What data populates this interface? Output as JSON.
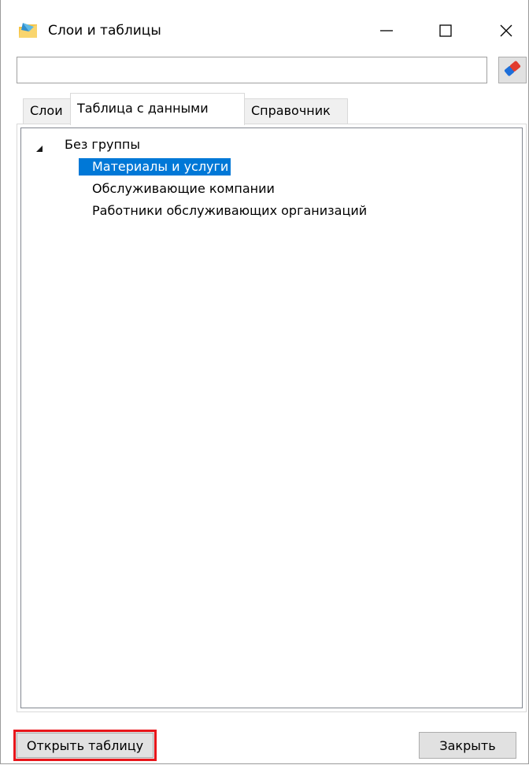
{
  "window": {
    "title": "Слои и таблицы",
    "app_icon": "folder-envelope-icon",
    "controls": {
      "minimize_icon": "minimize-icon",
      "maximize_icon": "maximize-icon",
      "close_icon": "close-icon"
    }
  },
  "search": {
    "value": "",
    "placeholder": "",
    "clear_icon": "eraser-icon"
  },
  "tabs": [
    {
      "label": "Слои",
      "selected": false
    },
    {
      "label": "Таблица с данными",
      "selected": true
    },
    {
      "label": "Справочник",
      "selected": false
    }
  ],
  "tree": {
    "group": {
      "label": "Без группы",
      "expanded": true,
      "items": [
        {
          "label": "Материалы и услуги",
          "selected": true
        },
        {
          "label": "Обслуживающие компании",
          "selected": false
        },
        {
          "label": "Работники обслуживающих организаций",
          "selected": false
        }
      ]
    }
  },
  "buttons": {
    "open_table": "Открыть таблицу",
    "close": "Закрыть"
  },
  "colors": {
    "selection": "#0078d7",
    "highlight_border": "#e8161b",
    "button_face": "#e1e1e1"
  }
}
